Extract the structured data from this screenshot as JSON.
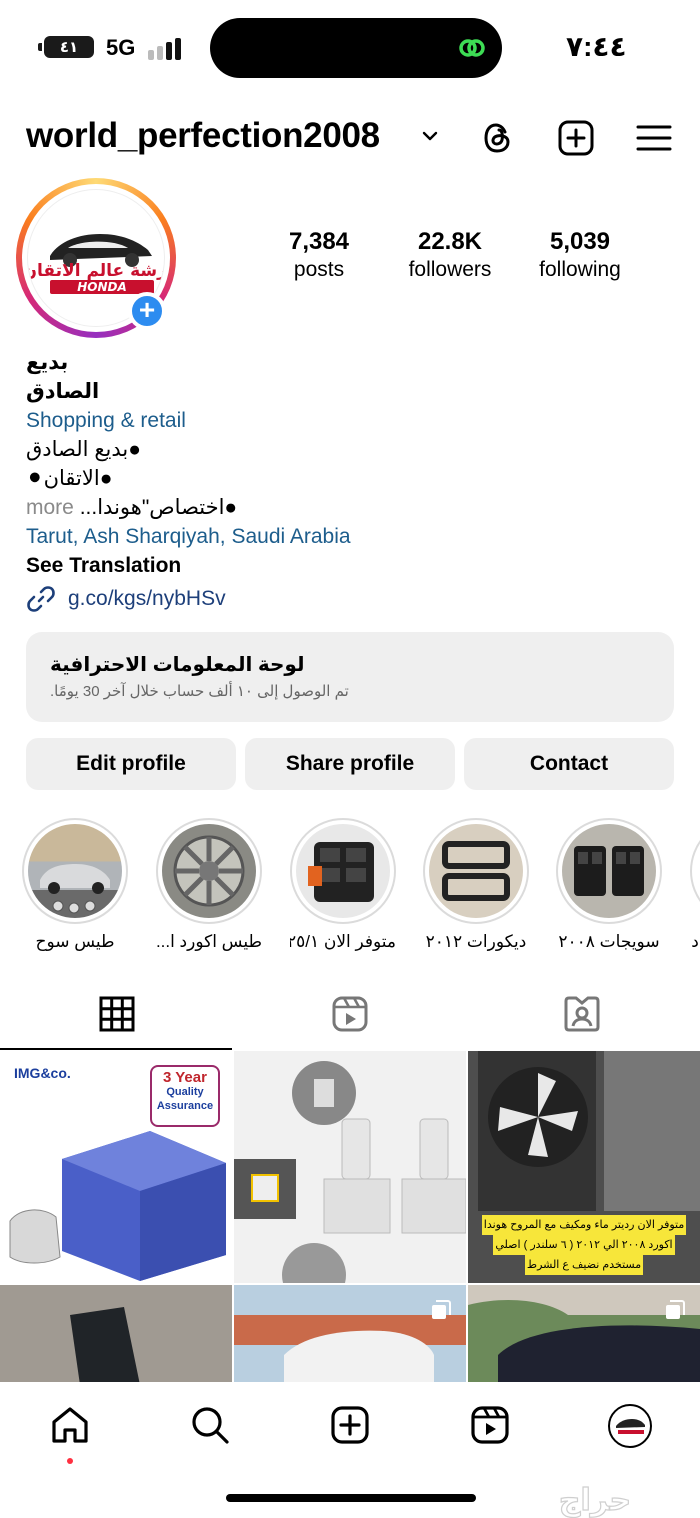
{
  "status_bar": {
    "battery": "٤١",
    "network": "5G",
    "time": "٧:٤٤"
  },
  "header": {
    "username": "world_perfection2008",
    "icons": [
      "chevron-down-icon",
      "threads-icon",
      "create-icon",
      "menu-icon"
    ]
  },
  "profile": {
    "logo_text_ar": "ورشة عالم الاتقان",
    "logo_text_en": "HONDA",
    "stats": [
      {
        "value": "7,384",
        "label": "posts"
      },
      {
        "value": "22.8K",
        "label": "followers"
      },
      {
        "value": "5,039",
        "label": "following"
      }
    ]
  },
  "bio": {
    "name": "بديع الصادق",
    "category": "Shopping & retail",
    "line1": "●بديع الصادق",
    "line2": "●الاتقان⚫",
    "line3_text": "●اختصاص\"هوندا...",
    "more": "more",
    "location": "Tarut, Ash Sharqiyah, Saudi Arabia",
    "see_translation": "See Translation",
    "link": "g.co/kgs/nybHSv"
  },
  "dashboard": {
    "title": "لوحة المعلومات الاحترافية",
    "subtitle": "تم الوصول إلى ١٠ ألف حساب خلال آخر 30 يومًا."
  },
  "buttons": {
    "edit": "Edit profile",
    "share": "Share profile",
    "contact": "Contact"
  },
  "highlights": [
    {
      "label": "طيس سوح"
    },
    {
      "label": "طيس اكورد ا..."
    },
    {
      "label": "متوفر الان ٢٥/١"
    },
    {
      "label": "ديكورات ٢٠١٢"
    },
    {
      "label": "سويجات ٢٠٠٨"
    },
    {
      "label": "د"
    }
  ],
  "tabs": [
    "grid-icon",
    "reels-icon",
    "tagged-icon"
  ],
  "grid": {
    "post1_brand": "IMG&co.",
    "post1_badge_l1": "3 Year",
    "post1_badge_l2": "Quality",
    "post1_badge_l3": "Assurance",
    "post3_caption_l1": "متوفر الان رديتر ماء ومكيف مع المروح هوندا",
    "post3_caption_l2": "اكورد ٢٠٠٨ الي ٢٠١٢ ( ٦ سلندر ) اصلي",
    "post3_caption_l3": "مستخدم نضيف ع الشرط"
  },
  "bottom_nav": [
    "home-icon",
    "search-icon",
    "create-icon",
    "reels-icon",
    "profile-avatar"
  ],
  "watermark": "حراج"
}
